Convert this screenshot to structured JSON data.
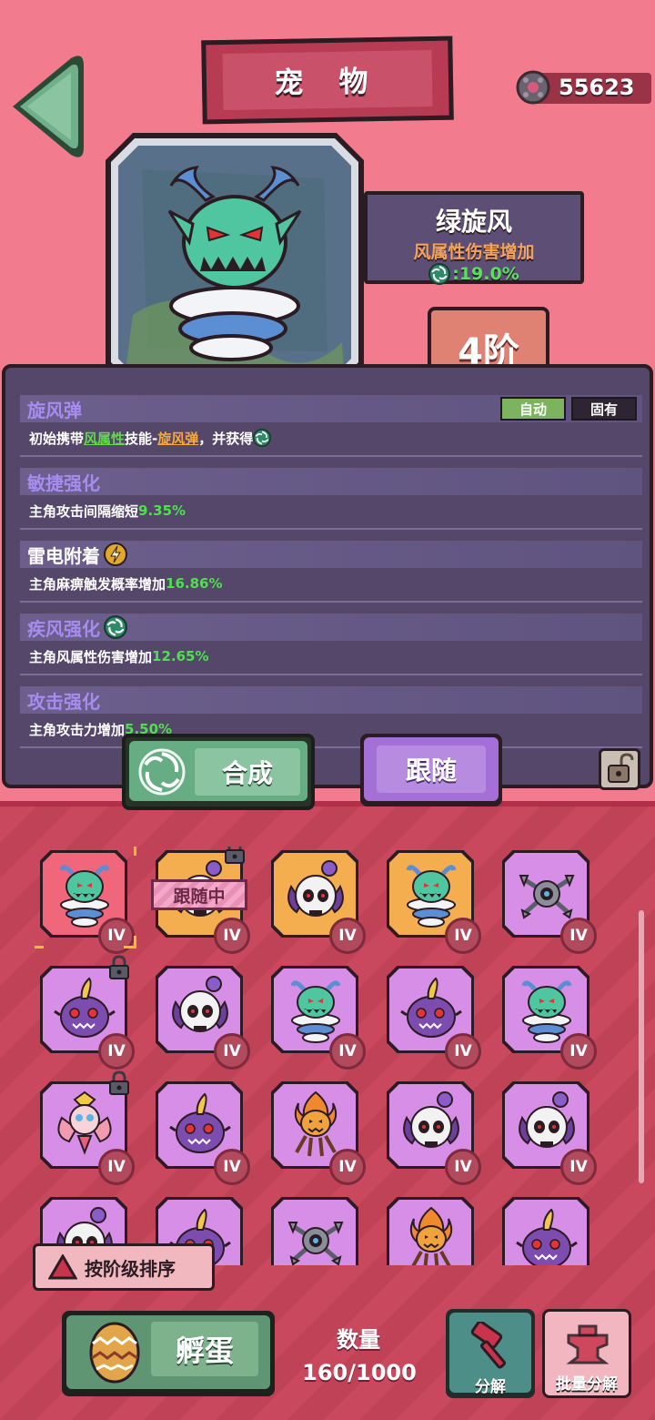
{
  "header": {
    "title": "宠 物",
    "currency_value": "55623"
  },
  "pet": {
    "name": "绿旋风",
    "attribute": "风属性伤害增加",
    "bonus": ":19.0%",
    "rank": "4阶"
  },
  "skills": [
    {
      "title": "旋风弹",
      "tags": [
        "自动",
        "固有"
      ],
      "desc_prefix": "初始携带",
      "desc_hl1": "风属性",
      "desc_mid": "技能-",
      "desc_hl2": "旋风弹",
      "desc_suffix": "，并获得"
    },
    {
      "title": "敏捷强化",
      "desc": "主角攻击间隔缩短",
      "value": "9.35%"
    },
    {
      "title": "雷电附着",
      "desc": "主角麻痹触发概率增加",
      "value": "16.86%"
    },
    {
      "title": "疾风强化",
      "desc": "主角风属性伤害增加",
      "value": "12.65%"
    },
    {
      "title": "攻击强化",
      "desc": "主角攻击力增加",
      "value": "5.50%"
    }
  ],
  "actions": {
    "compose": "合成",
    "follow": "跟随"
  },
  "grid": {
    "follow_tag": "跟随中",
    "cells": [
      {
        "creature": "cyclone",
        "bg": "red",
        "level": "IV"
      },
      {
        "creature": "skull",
        "bg": "orange",
        "level": "IV"
      },
      {
        "creature": "skull",
        "bg": "orange",
        "level": "IV"
      },
      {
        "creature": "cyclone",
        "bg": "orange",
        "level": "IV"
      },
      {
        "creature": "drone",
        "bg": "purple",
        "level": "IV"
      },
      {
        "creature": "horn",
        "bg": "purple",
        "level": "IV"
      },
      {
        "creature": "skull",
        "bg": "purple",
        "level": "IV"
      },
      {
        "creature": "cyclone",
        "bg": "purple",
        "level": "IV"
      },
      {
        "creature": "horn",
        "bg": "purple",
        "level": "IV"
      },
      {
        "creature": "cyclone",
        "bg": "purple",
        "level": "IV"
      },
      {
        "creature": "fairy",
        "bg": "purple",
        "level": "IV"
      },
      {
        "creature": "horn",
        "bg": "purple",
        "level": "IV"
      },
      {
        "creature": "flame",
        "bg": "purple",
        "level": "IV"
      },
      {
        "creature": "skull",
        "bg": "purple",
        "level": "IV"
      },
      {
        "creature": "skull",
        "bg": "purple",
        "level": "IV"
      },
      {
        "creature": "skull",
        "bg": "purple",
        "level": ""
      },
      {
        "creature": "horn",
        "bg": "purple",
        "level": ""
      },
      {
        "creature": "drone",
        "bg": "purple",
        "level": ""
      },
      {
        "creature": "flame",
        "bg": "purple",
        "level": ""
      },
      {
        "creature": "horn",
        "bg": "purple",
        "level": ""
      }
    ]
  },
  "sort_label": "按阶级排序",
  "hatch_label": "孵蛋",
  "quantity": {
    "label": "数量",
    "value": "160/1000"
  },
  "decompose_label": "分解",
  "batch_decompose_label": "批量分解"
}
